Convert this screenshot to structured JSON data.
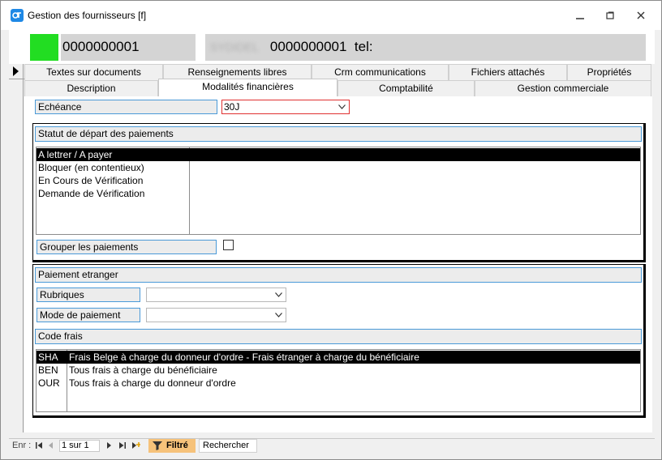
{
  "window": {
    "title": "Gestion des fournisseurs [f]"
  },
  "header": {
    "code": "0000000001",
    "name_redacted": "SYDIDEL",
    "name_code": "0000000001",
    "tel_label": "tel:"
  },
  "tabs": {
    "row1": [
      {
        "label": "Textes sur documents"
      },
      {
        "label": "Renseignements libres"
      },
      {
        "label": "Crm communications"
      },
      {
        "label": "Fichiers attachés"
      },
      {
        "label": "Propriétés"
      }
    ],
    "row2": [
      {
        "label": "Description"
      },
      {
        "label": "Modalités financières",
        "active": true
      },
      {
        "label": "Comptabilité"
      },
      {
        "label": "Gestion commerciale"
      }
    ]
  },
  "echeance": {
    "label": "Echéance",
    "value": "30J"
  },
  "statut": {
    "title": "Statut de départ des paiements",
    "items": [
      "A lettrer / A payer",
      "Bloquer (en contentieux)",
      "En Cours de Vérification",
      "Demande de Vérification"
    ],
    "selected_index": 0
  },
  "grouper": {
    "label": "Grouper les paiements",
    "checked": false
  },
  "etranger": {
    "title": "Paiement etranger",
    "rubriques_label": "Rubriques",
    "rubriques_value": "",
    "mode_label": "Mode de paiement",
    "mode_value": "",
    "code_frais_title": "Code frais",
    "code_frais": [
      {
        "code": "SHA",
        "desc": "Frais Belge à charge du donneur d'ordre - Frais étranger à charge du bénéficiaire"
      },
      {
        "code": "BEN",
        "desc": "Tous frais à charge du bénéficiaire"
      },
      {
        "code": "OUR",
        "desc": "Tous frais à charge du donneur d'ordre"
      }
    ],
    "selected_index": 0
  },
  "footer": {
    "enr_label": "Enr :",
    "position": "1 sur 1",
    "filter_label": "Filtré",
    "search_label": "Rechercher"
  },
  "colors": {
    "accent_border": "#4a9ad8",
    "status_green": "#22dd22",
    "filter_bg": "#f6c27a",
    "required_border": "#e03030"
  }
}
